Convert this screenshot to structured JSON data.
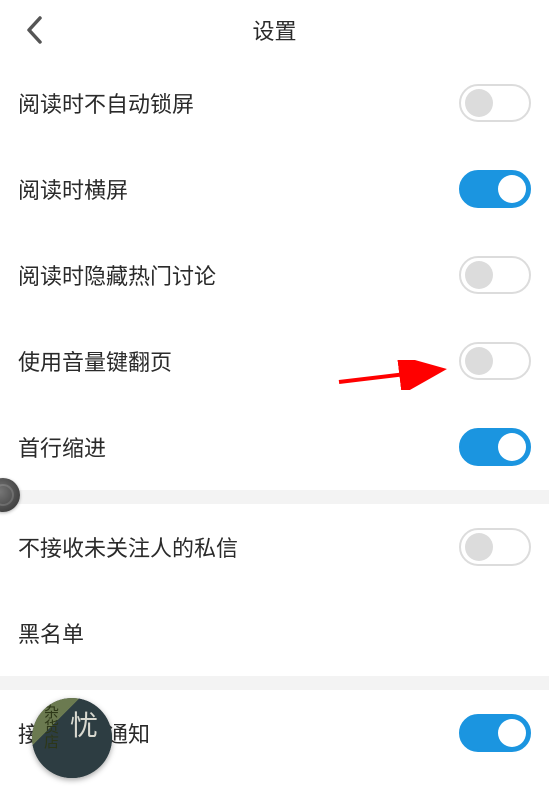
{
  "header": {
    "title": "设置"
  },
  "rows": [
    {
      "label": "阅读时不自动锁屏",
      "type": "toggle",
      "on": false
    },
    {
      "label": "阅读时横屏",
      "type": "toggle",
      "on": true
    },
    {
      "label": "阅读时隐藏热门讨论",
      "type": "toggle",
      "on": false
    },
    {
      "label": "使用音量键翻页",
      "type": "toggle",
      "on": false
    },
    {
      "label": "首行缩进",
      "type": "toggle",
      "on": true
    }
  ],
  "rows2": [
    {
      "label": "不接收未关注人的私信",
      "type": "toggle",
      "on": false
    },
    {
      "label": "黑名单",
      "type": "link"
    }
  ],
  "rows3": [
    {
      "label": "接收推送通知",
      "type": "toggle",
      "on": true
    }
  ],
  "floater": {
    "t1": "杂货店",
    "t2": "忧"
  },
  "arrow": {
    "color": "#ff0000"
  }
}
